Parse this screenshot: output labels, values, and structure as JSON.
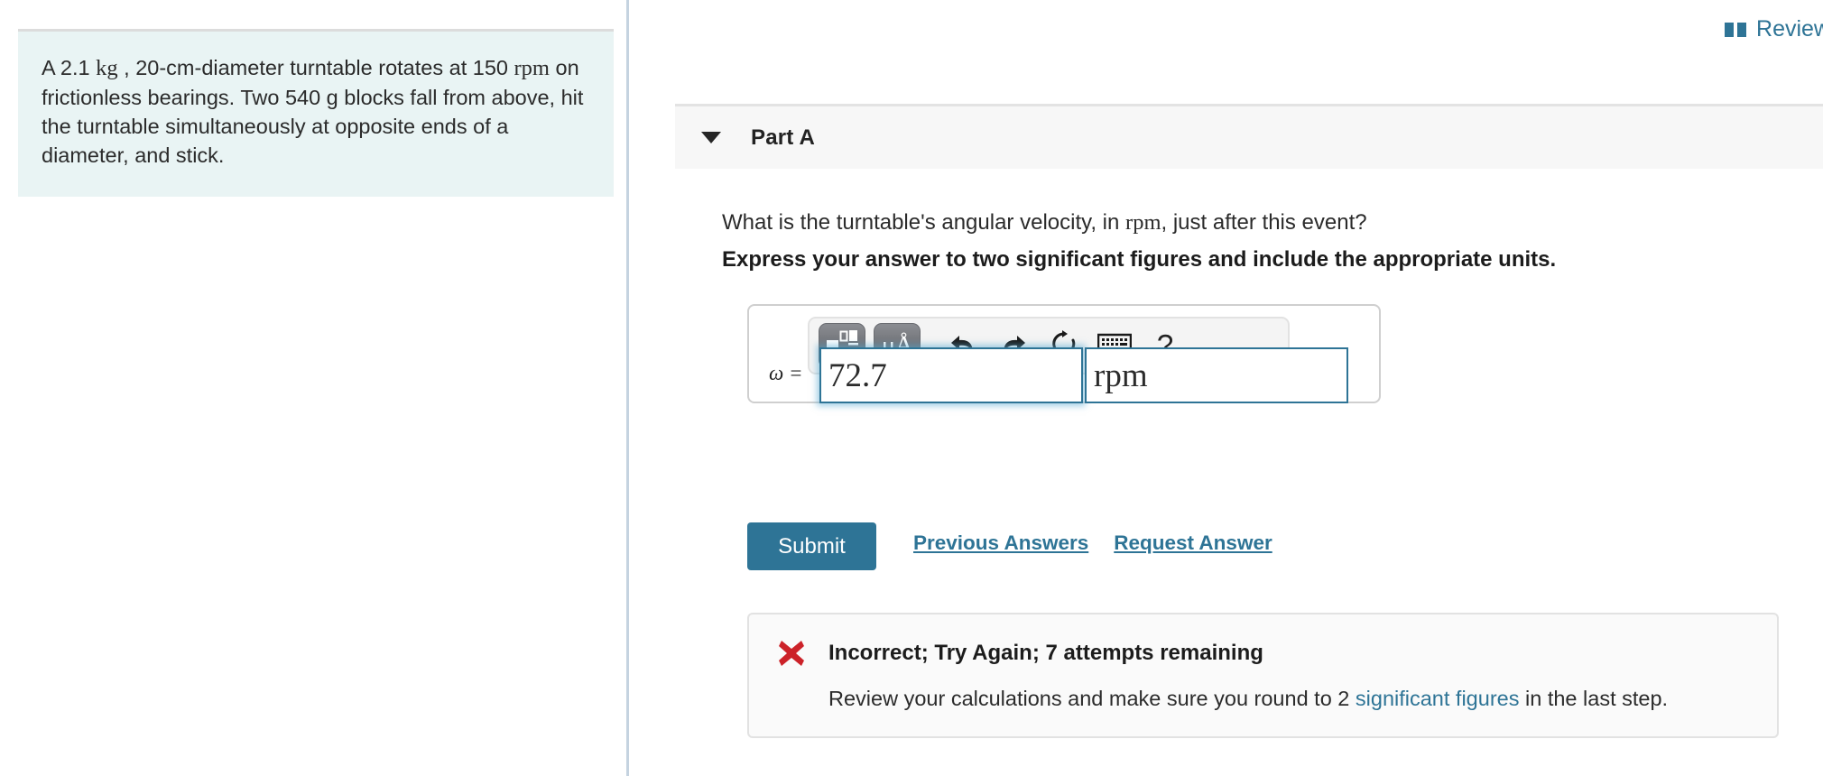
{
  "problem": {
    "text_part1": "A 2.1 ",
    "unit_kg": "kg",
    "text_part2": " , 20-cm-diameter turntable rotates at 150 ",
    "unit_rpm": "rpm",
    "text_part3": " on frictionless bearings. Two 540 g blocks fall from above, hit the turntable simultaneously at opposite ends of a diameter, and stick."
  },
  "header": {
    "review_label": "Review",
    "review_icon": "open-book-icon"
  },
  "part": {
    "title": "Part A",
    "caret_icon": "chevron-down-icon",
    "question_pre": "What is the turntable's angular velocity, in ",
    "question_unit": "rpm",
    "question_post": ", just after this event?",
    "instruction": "Express your answer to two significant figures and include the appropriate units."
  },
  "answer": {
    "toolbar": [
      {
        "name": "template-button",
        "icon": "math-template-icon",
        "style": "dark"
      },
      {
        "name": "units-button",
        "icon": "mu-angstrom-icon",
        "label": "μÅ",
        "style": "dark"
      },
      {
        "name": "undo-button",
        "icon": "undo-arrow-icon",
        "style": "plain"
      },
      {
        "name": "redo-button",
        "icon": "redo-arrow-icon",
        "style": "plain"
      },
      {
        "name": "reset-button",
        "icon": "refresh-icon",
        "style": "plain"
      },
      {
        "name": "keyboard-button",
        "icon": "keyboard-icon",
        "style": "plain"
      },
      {
        "name": "help-button",
        "icon": "question-mark-icon",
        "label": "?",
        "style": "plain"
      }
    ],
    "variable_label": "ω =",
    "value": "72.7",
    "value_placeholder": "",
    "units": "rpm",
    "units_placeholder": ""
  },
  "actions": {
    "submit_label": "Submit",
    "previous_answers_label": "Previous Answers",
    "request_answer_label": "Request Answer"
  },
  "feedback": {
    "status_icon": "red-x-icon",
    "title": "Incorrect; Try Again; 7 attempts remaining",
    "body_pre": "Review your calculations and make sure you round to 2 ",
    "body_link": "significant figures",
    "body_post": " in the last step."
  },
  "colors": {
    "accent": "#2e7496",
    "problem_bg": "#e9f4f4",
    "error_red": "#cc2229",
    "header_bg": "#f7f7f7"
  }
}
